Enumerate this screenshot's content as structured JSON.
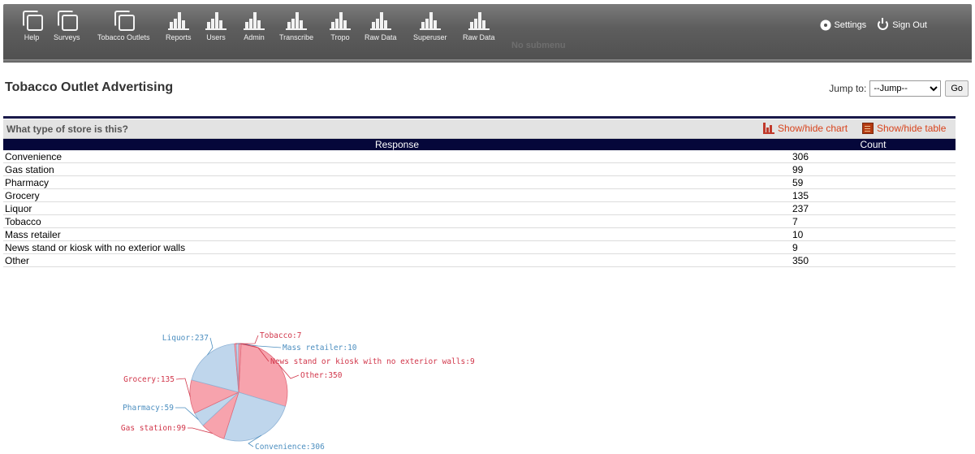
{
  "nav": {
    "items": [
      {
        "label": "Help",
        "icon": "copy-icon"
      },
      {
        "label": "Surveys",
        "icon": "copy-icon"
      },
      {
        "label": "Tobacco Outlets",
        "icon": "copy-icon"
      },
      {
        "label": "Reports",
        "icon": "bar-chart-icon"
      },
      {
        "label": "Users",
        "icon": "bar-chart-icon"
      },
      {
        "label": "Admin",
        "icon": "bar-chart-icon"
      },
      {
        "label": "Transcribe",
        "icon": "bar-chart-icon"
      },
      {
        "label": "Tropo",
        "icon": "bar-chart-icon"
      },
      {
        "label": "Raw Data",
        "icon": "bar-chart-icon"
      },
      {
        "label": "Superuser",
        "icon": "bar-chart-icon"
      },
      {
        "label": "Raw Data",
        "icon": "bar-chart-icon"
      }
    ],
    "no_submenu": "No submenu",
    "settings_label": "Settings",
    "signout_label": "Sign Out"
  },
  "page": {
    "title": "Tobacco Outlet Advertising",
    "jump_label": "Jump to:",
    "jump_selected": "--Jump--",
    "go_label": "Go"
  },
  "question": {
    "text": "What type of store is this?",
    "show_chart": "Show/hide chart",
    "show_table": "Show/hide table"
  },
  "table": {
    "headers": [
      "Response",
      "Count"
    ],
    "rows": [
      {
        "response": "Convenience",
        "count": "306"
      },
      {
        "response": "Gas station",
        "count": "99"
      },
      {
        "response": "Pharmacy",
        "count": "59"
      },
      {
        "response": "Grocery",
        "count": "135"
      },
      {
        "response": "Liquor",
        "count": "237"
      },
      {
        "response": "Tobacco",
        "count": "7"
      },
      {
        "response": "Mass retailer",
        "count": "10"
      },
      {
        "response": "News stand or kiosk with no exterior walls",
        "count": "9"
      },
      {
        "response": "Other",
        "count": "350"
      }
    ]
  },
  "colors": {
    "pink_fill": "#f7a3ad",
    "blue_fill": "#bfd6ec",
    "pink_text": "#d1364a",
    "blue_text": "#4d8fc0",
    "header_bg": "#05073a",
    "toggle_text": "#d8431c"
  },
  "chart_data": {
    "type": "pie",
    "slices": [
      {
        "label": "Other",
        "value": 350,
        "display": "Other:350"
      },
      {
        "label": "Convenience",
        "value": 306,
        "display": "Convenience:306"
      },
      {
        "label": "Gas station",
        "value": 99,
        "display": "Gas station:99"
      },
      {
        "label": "Pharmacy",
        "value": 59,
        "display": "Pharmacy:59"
      },
      {
        "label": "Grocery",
        "value": 135,
        "display": "Grocery:135"
      },
      {
        "label": "Liquor",
        "value": 237,
        "display": "Liquor:237"
      },
      {
        "label": "Tobacco",
        "value": 7,
        "display": "Tobacco:7"
      },
      {
        "label": "Mass retailer",
        "value": 10,
        "display": "Mass retailer:10"
      },
      {
        "label": "News stand or kiosk with no exterior walls",
        "value": 9,
        "display": "News stand or kiosk with no exterior walls:9"
      }
    ]
  }
}
